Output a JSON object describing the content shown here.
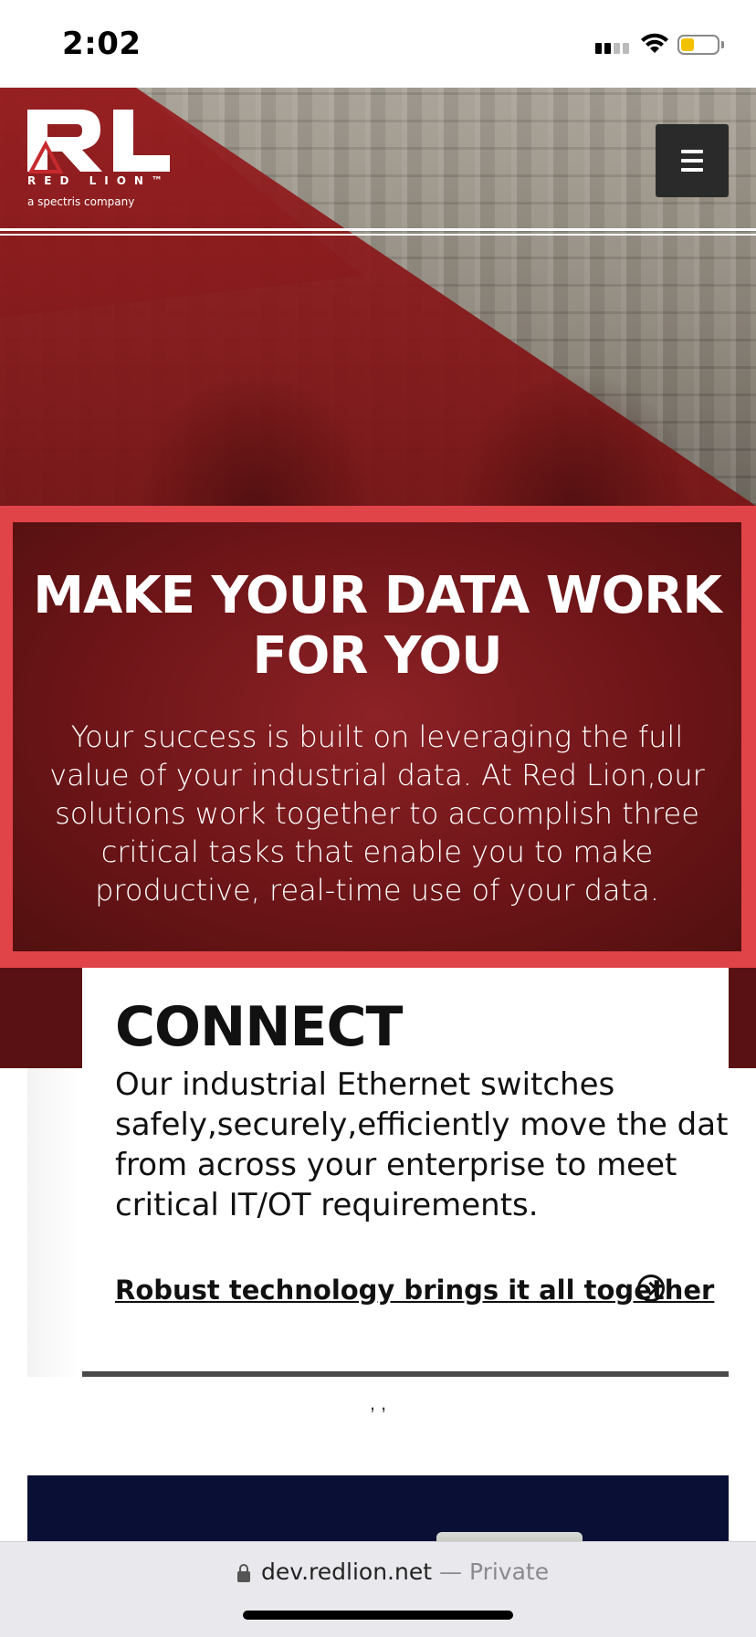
{
  "status_bar": {
    "time": "2:02"
  },
  "header": {
    "logo_letters": "RL",
    "logo_word": "RED LION™",
    "logo_tagline": "a spectris company",
    "menu_label": "menu"
  },
  "banner": {
    "title": "MAKE YOUR DATA WORK FOR YOU",
    "text": "Your success is built on leveraging the full value of your industrial data. At Red Lion,our solutions work together to accomplish three critical tasks that enable you to make productive, real-time use of your data."
  },
  "card": {
    "title": "CONNECT",
    "text": "Our industrial Ethernet switches safely,securely,efficiently move the data from across your enterprise to meet critical IT/OT requirements.",
    "link_label": "Robust technology brings it all together"
  },
  "pager": {
    "dots": ", ,"
  },
  "browser": {
    "url": "dev.redlion.net",
    "mode": "— Private"
  },
  "colors": {
    "brand_red": "#e04448",
    "banner_dark": "#6e1518",
    "navy": "#0a0f35",
    "menu_bg": "#2a2a2a"
  },
  "icons": [
    "signal-icon",
    "wifi-icon",
    "battery-icon",
    "hamburger-icon",
    "arrow-circle-icon",
    "lock-icon"
  ]
}
